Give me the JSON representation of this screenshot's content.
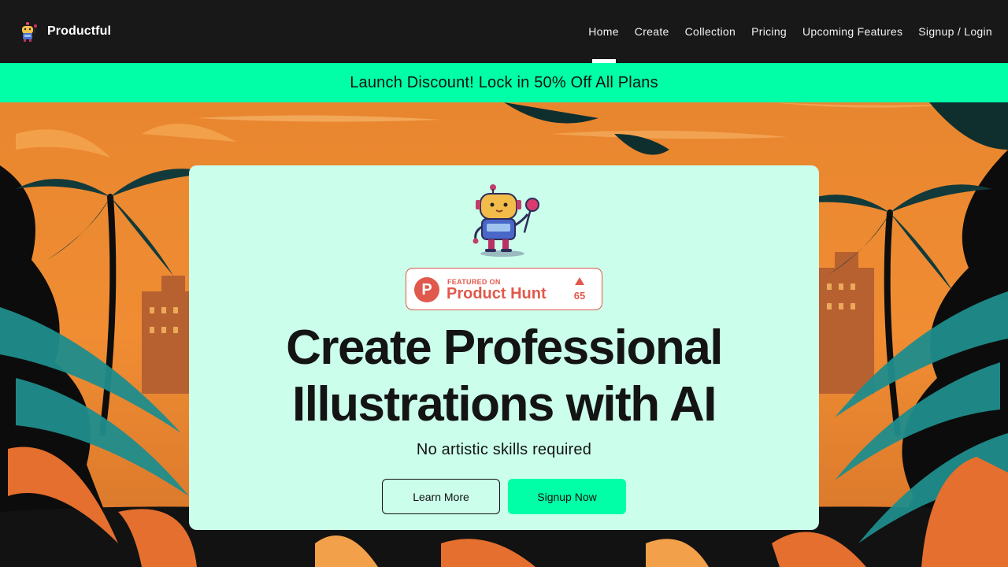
{
  "brand": {
    "name": "Productful",
    "logo_icon": "robot-logo-icon"
  },
  "nav": {
    "items": [
      {
        "label": "Home",
        "active": true
      },
      {
        "label": "Create"
      },
      {
        "label": "Collection"
      },
      {
        "label": "Pricing"
      },
      {
        "label": "Upcoming Features"
      },
      {
        "label": "Signup / Login"
      }
    ]
  },
  "banner": {
    "text": "Launch Discount! Lock in 50% Off All Plans"
  },
  "hero": {
    "mascot_icon": "robot-mascot-icon",
    "product_hunt": {
      "featured": "FEATURED ON",
      "name": "Product Hunt",
      "votes": "65"
    },
    "headline_line1": "Create Professional",
    "headline_line2": "Illustrations with AI",
    "subheadline": "No artistic skills required",
    "learn_more": "Learn More",
    "signup_now": "Signup Now"
  },
  "colors": {
    "navbar_bg": "#181818",
    "accent_green": "#00ffa6",
    "card_bg": "#cbfeeb",
    "product_hunt_red": "#e0594c",
    "sunset_orange": "#ee8a34"
  }
}
